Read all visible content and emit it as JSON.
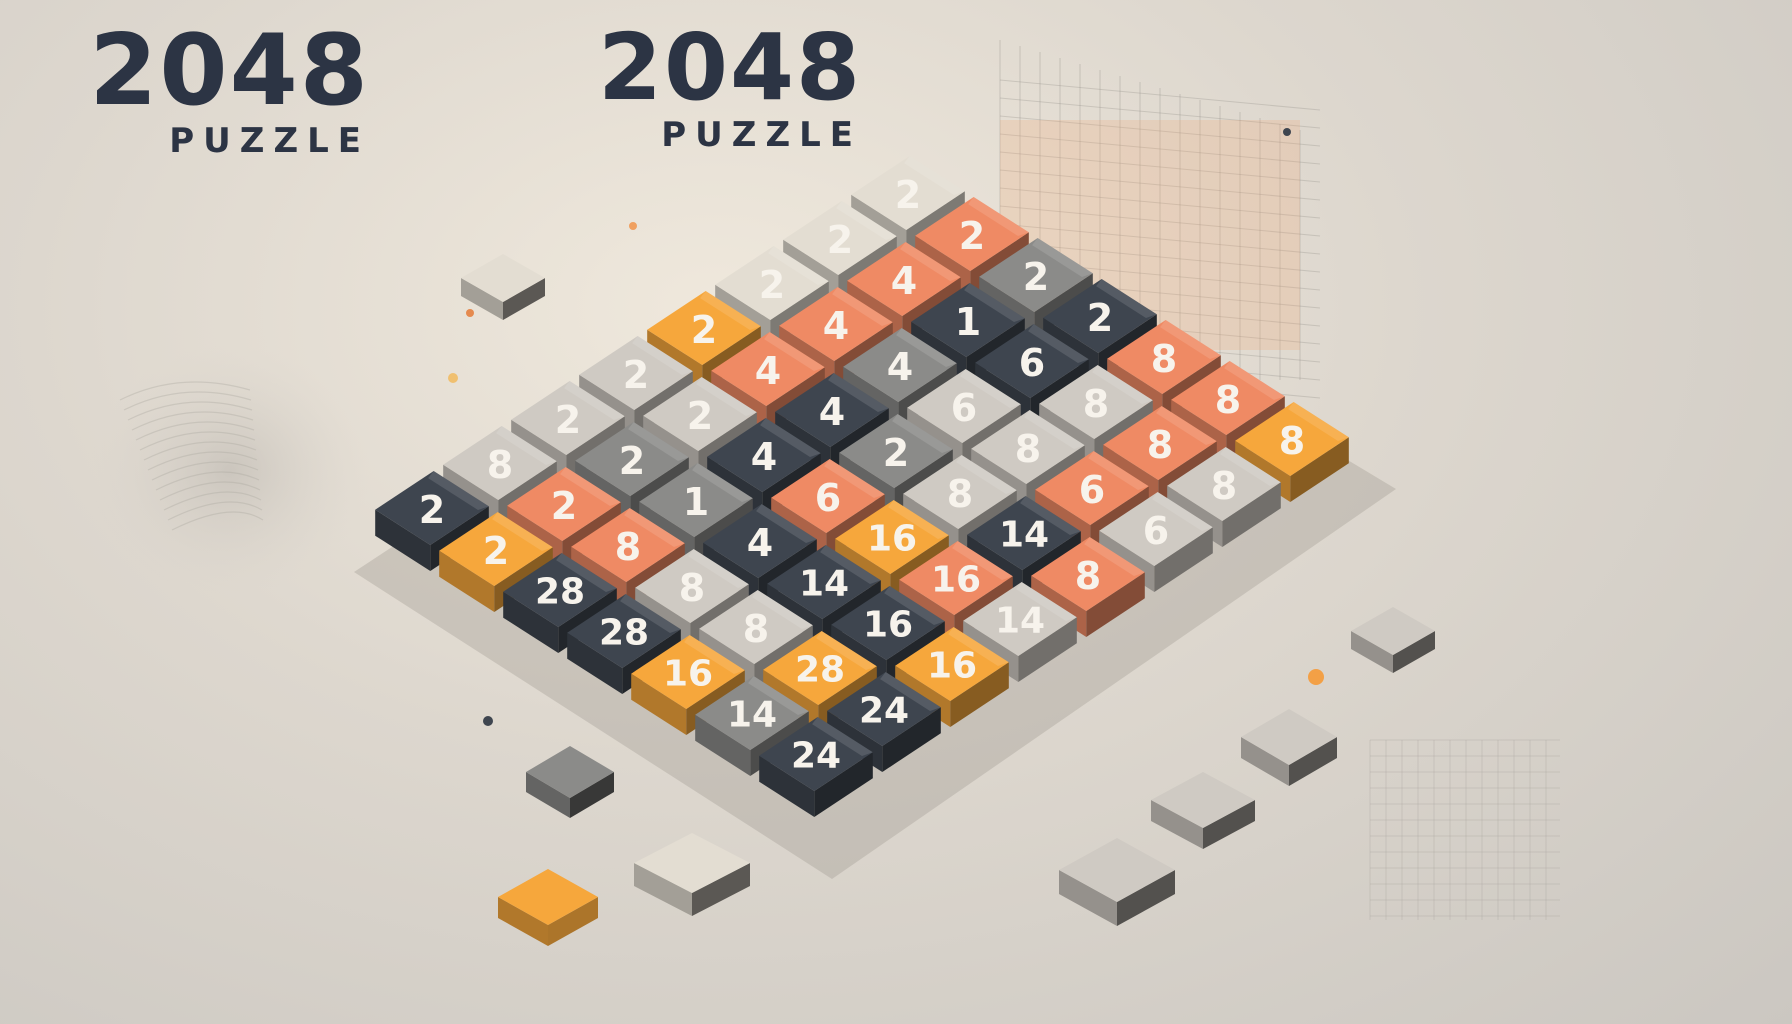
{
  "logos": [
    {
      "title": "2048",
      "subtitle": "PUZZLE"
    },
    {
      "title": "2048",
      "subtitle": "PUZZLE"
    }
  ],
  "palette": {
    "dark": "#3e454f",
    "gray": "#8b8b89",
    "light": "#cfcac3",
    "cream": "#e3ddd2",
    "salmon": "#ef8a64",
    "orange": "#f6a73c",
    "title_color": "#2c3444"
  },
  "board": {
    "rows": [
      [
        {
          "value": "2",
          "color": "cream"
        },
        {
          "value": "2",
          "color": "salmon"
        },
        {
          "value": "2",
          "color": "gray"
        },
        {
          "value": "2",
          "color": "dark"
        },
        {
          "value": "8",
          "color": "salmon"
        },
        {
          "value": "8",
          "color": "salmon"
        },
        {
          "value": "8",
          "color": "orange"
        }
      ],
      [
        {
          "value": "2",
          "color": "cream"
        },
        {
          "value": "4",
          "color": "salmon"
        },
        {
          "value": "1",
          "color": "dark"
        },
        {
          "value": "6",
          "color": "dark"
        },
        {
          "value": "8",
          "color": "light"
        },
        {
          "value": "8",
          "color": "salmon"
        },
        {
          "value": "8",
          "color": "light"
        }
      ],
      [
        {
          "value": "2",
          "color": "cream"
        },
        {
          "value": "4",
          "color": "salmon"
        },
        {
          "value": "4",
          "color": "gray"
        },
        {
          "value": "6",
          "color": "light"
        },
        {
          "value": "8",
          "color": "light"
        },
        {
          "value": "6",
          "color": "salmon"
        },
        {
          "value": "6",
          "color": "light"
        }
      ],
      [
        {
          "value": "2",
          "color": "orange"
        },
        {
          "value": "4",
          "color": "salmon"
        },
        {
          "value": "4",
          "color": "dark"
        },
        {
          "value": "2",
          "color": "gray"
        },
        {
          "value": "8",
          "color": "light"
        },
        {
          "value": "14",
          "color": "dark"
        },
        {
          "value": "8",
          "color": "salmon"
        }
      ],
      [
        {
          "value": "2",
          "color": "light"
        },
        {
          "value": "2",
          "color": "light"
        },
        {
          "value": "4",
          "color": "dark"
        },
        {
          "value": "6",
          "color": "salmon"
        },
        {
          "value": "16",
          "color": "orange"
        },
        {
          "value": "16",
          "color": "salmon"
        },
        {
          "value": "14",
          "color": "light"
        }
      ],
      [
        {
          "value": "2",
          "color": "light"
        },
        {
          "value": "2",
          "color": "gray"
        },
        {
          "value": "1",
          "color": "gray"
        },
        {
          "value": "4",
          "color": "dark"
        },
        {
          "value": "14",
          "color": "dark"
        },
        {
          "value": "16",
          "color": "dark"
        },
        {
          "value": "16",
          "color": "orange"
        }
      ],
      [
        {
          "value": "8",
          "color": "light"
        },
        {
          "value": "2",
          "color": "salmon"
        },
        {
          "value": "8",
          "color": "salmon"
        },
        {
          "value": "8",
          "color": "light"
        },
        {
          "value": "8",
          "color": "light"
        },
        {
          "value": "28",
          "color": "orange"
        },
        {
          "value": "24",
          "color": "dark"
        }
      ],
      [
        {
          "value": "2",
          "color": "dark"
        },
        {
          "value": "2",
          "color": "orange"
        },
        {
          "value": "28",
          "color": "dark"
        },
        {
          "value": "28",
          "color": "dark"
        },
        {
          "value": "16",
          "color": "orange"
        },
        {
          "value": "14",
          "color": "gray"
        },
        {
          "value": "24",
          "color": "dark"
        }
      ]
    ]
  },
  "loose_blocks": [
    {
      "color": "cream"
    },
    {
      "color": "gray"
    },
    {
      "color": "cream"
    },
    {
      "color": "orange"
    },
    {
      "color": "light"
    },
    {
      "color": "light"
    },
    {
      "color": "light"
    },
    {
      "color": "light"
    }
  ]
}
